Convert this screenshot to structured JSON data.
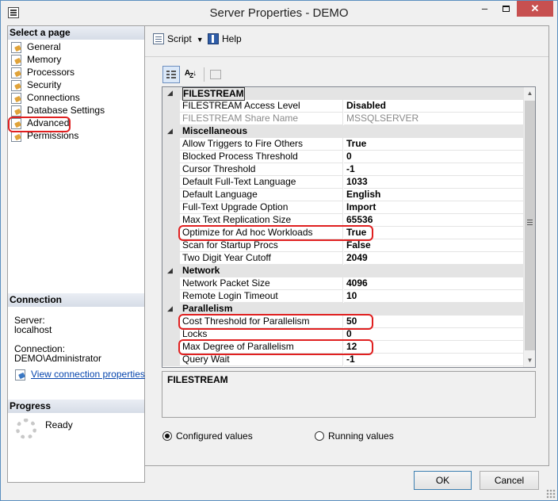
{
  "window": {
    "title": "Server Properties - DEMO"
  },
  "left": {
    "select_page_header": "Select a page",
    "pages": [
      {
        "label": "General"
      },
      {
        "label": "Memory"
      },
      {
        "label": "Processors"
      },
      {
        "label": "Security"
      },
      {
        "label": "Connections"
      },
      {
        "label": "Database Settings"
      },
      {
        "label": "Advanced"
      },
      {
        "label": "Permissions"
      }
    ],
    "connection_header": "Connection",
    "server_label": "Server:",
    "server_value": "localhost",
    "connection_label": "Connection:",
    "connection_value": "DEMO\\Administrator",
    "view_link": "View connection properties",
    "progress_header": "Progress",
    "progress_status": "Ready"
  },
  "toolbar": {
    "script_label": "Script",
    "help_label": "Help"
  },
  "grid": {
    "categories": {
      "filestream": "FILESTREAM",
      "misc": "Miscellaneous",
      "network": "Network",
      "parallelism": "Parallelism"
    },
    "rows": [
      {
        "name": "FILESTREAM Access Level",
        "value": "Disabled"
      },
      {
        "name": "FILESTREAM Share Name",
        "value": "MSSQLSERVER"
      },
      {
        "name": "Allow Triggers to Fire Others",
        "value": "True"
      },
      {
        "name": "Blocked Process Threshold",
        "value": "0"
      },
      {
        "name": "Cursor Threshold",
        "value": "-1"
      },
      {
        "name": "Default Full-Text Language",
        "value": "1033"
      },
      {
        "name": "Default Language",
        "value": "English"
      },
      {
        "name": "Full-Text Upgrade Option",
        "value": "Import"
      },
      {
        "name": "Max Text Replication Size",
        "value": "65536"
      },
      {
        "name": "Optimize for Ad hoc Workloads",
        "value": "True"
      },
      {
        "name": "Scan for Startup Procs",
        "value": "False"
      },
      {
        "name": "Two Digit Year Cutoff",
        "value": "2049"
      },
      {
        "name": "Network Packet Size",
        "value": "4096"
      },
      {
        "name": "Remote Login Timeout",
        "value": "10"
      },
      {
        "name": "Cost Threshold for Parallelism",
        "value": "50"
      },
      {
        "name": "Locks",
        "value": "0"
      },
      {
        "name": "Max Degree of Parallelism",
        "value": "12"
      },
      {
        "name": "Query Wait",
        "value": "-1"
      }
    ]
  },
  "description": {
    "title": "FILESTREAM"
  },
  "radios": {
    "configured": "Configured values",
    "running": "Running values",
    "selected": "configured"
  },
  "buttons": {
    "ok": "OK",
    "cancel": "Cancel"
  }
}
